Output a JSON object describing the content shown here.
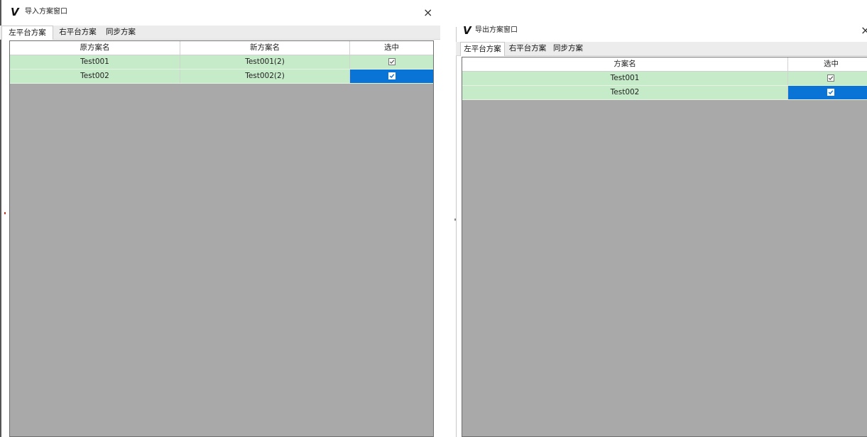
{
  "import_window": {
    "title": "导入方案窗口",
    "close_glyph": "×",
    "tabs": [
      {
        "label": "左平台方案",
        "active": true
      },
      {
        "label": "右平台方案",
        "active": false
      },
      {
        "label": "同步方案",
        "active": false
      }
    ],
    "columns": [
      "原方案名",
      "新方案名",
      "选中"
    ],
    "rows": [
      {
        "original_name": "Test001",
        "new_name": "Test001(2)",
        "checked": true,
        "selected": false
      },
      {
        "original_name": "Test002",
        "new_name": "Test002(2)",
        "checked": true,
        "selected": true
      }
    ]
  },
  "export_window": {
    "title": "导出方案窗口",
    "close_glyph": "×",
    "tabs": [
      {
        "label": "左平台方案",
        "active": true
      },
      {
        "label": "右平台方案",
        "active": false
      },
      {
        "label": "同步方案",
        "active": false
      }
    ],
    "columns": [
      "方案名",
      "选中"
    ],
    "rows": [
      {
        "name": "Test001",
        "checked": true,
        "selected": false
      },
      {
        "name": "Test002",
        "checked": true,
        "selected": true
      }
    ]
  },
  "icons": {
    "app_logo": "v-logo-icon",
    "close": "close-icon",
    "checkbox": "checkbox-checked-icon"
  },
  "colors": {
    "row_background": "#c6ebc9",
    "selected_cell": "#0a74d6",
    "empty_area": "#a9a9a9"
  }
}
